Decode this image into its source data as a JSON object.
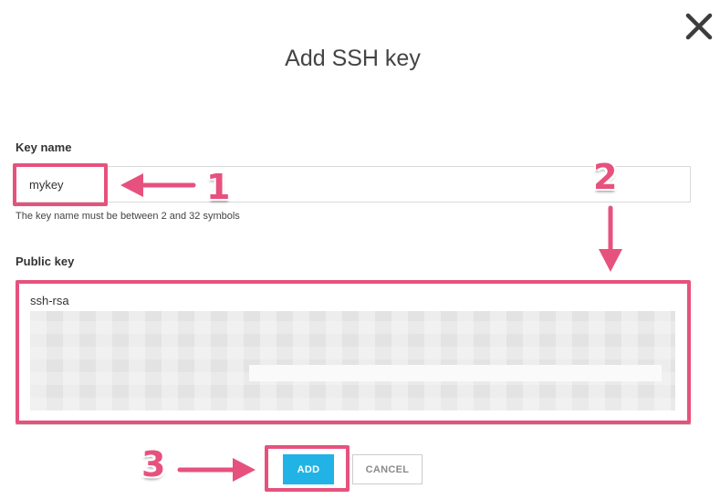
{
  "dialog": {
    "title": "Add SSH key",
    "close_icon": "close-icon"
  },
  "form": {
    "key_name": {
      "label": "Key name",
      "value": "mykey",
      "helper": "The key name must be between 2 and 32 symbols"
    },
    "public_key": {
      "label": "Public key",
      "prefix": "ssh-rsa",
      "blurred": true
    }
  },
  "buttons": {
    "add": "ADD",
    "cancel": "CANCEL"
  },
  "annotations": {
    "step_1": "1",
    "step_2": "2",
    "step_3": "3",
    "color": "#e6527d"
  },
  "colors": {
    "accent": "#21b3e6",
    "highlight": "#e6527d"
  }
}
